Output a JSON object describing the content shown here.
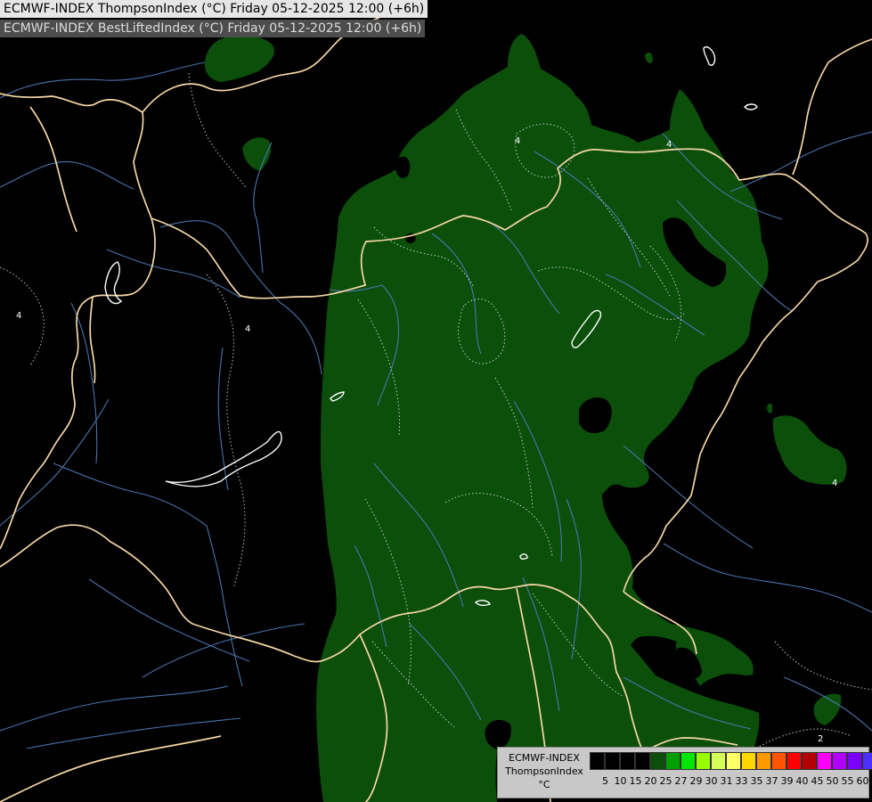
{
  "header": {
    "line1": "ECMWF-INDEX ThompsonIndex (°C) Friday 05-12-2025 12:00 (+6h)",
    "line2": "ECMWF-INDEX BestLiftedIndex (°C) Friday 05-12-2025 12:00 (+6h)"
  },
  "map": {
    "contour_labels": [
      "4",
      "4",
      "4",
      "4",
      "4",
      "2"
    ],
    "colors": {
      "background": "#000000",
      "fill": "#0b4f0b",
      "borders": "#f6d7a7",
      "rivers": "#4f79b5",
      "contours": "#dddddd"
    }
  },
  "legend": {
    "title_lines": [
      "ECMWF-INDEX",
      "ThompsonIndex",
      "°C"
    ],
    "ticks": [
      "5",
      "10",
      "15",
      "20",
      "25",
      "27",
      "29",
      "30",
      "31",
      "33",
      "35",
      "37",
      "39",
      "40",
      "45",
      "50",
      "55",
      "60"
    ],
    "colors": [
      "#000000",
      "#000000",
      "#000000",
      "#000000",
      "#0b4f0b",
      "#00a000",
      "#00e600",
      "#98ff00",
      "#d6ff5a",
      "#ffff66",
      "#ffd700",
      "#ff9900",
      "#ff5500",
      "#ff0000",
      "#b30000",
      "#ff00ff",
      "#b000ff",
      "#7a00ff",
      "#4d30ff",
      "#0000ff"
    ]
  }
}
